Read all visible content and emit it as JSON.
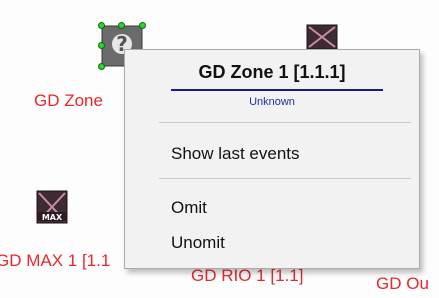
{
  "canvas": {
    "devices": [
      {
        "label": "GD Zone",
        "icon": "question-device-icon"
      },
      {
        "label": "GD MAX 1 [1.1",
        "icon": "wireless-device-icon",
        "badge": "MAX"
      },
      {
        "label": "GD RIO 1 [1.1]",
        "icon": "wireless-device-icon"
      },
      {
        "label": "GD Ou",
        "icon": "wireless-device-icon"
      }
    ]
  },
  "context_menu": {
    "title": "GD Zone 1 [1.1.1]",
    "subtitle": "Unknown",
    "items": [
      {
        "label": "Show last events"
      },
      {
        "label": "Omit"
      },
      {
        "label": "Unomit"
      }
    ]
  },
  "colors": {
    "device_label": "#e8282d",
    "selection_handle": "#2bd52b",
    "menu_background": "#f2f2f2",
    "title_underline": "#1a1a8a"
  }
}
